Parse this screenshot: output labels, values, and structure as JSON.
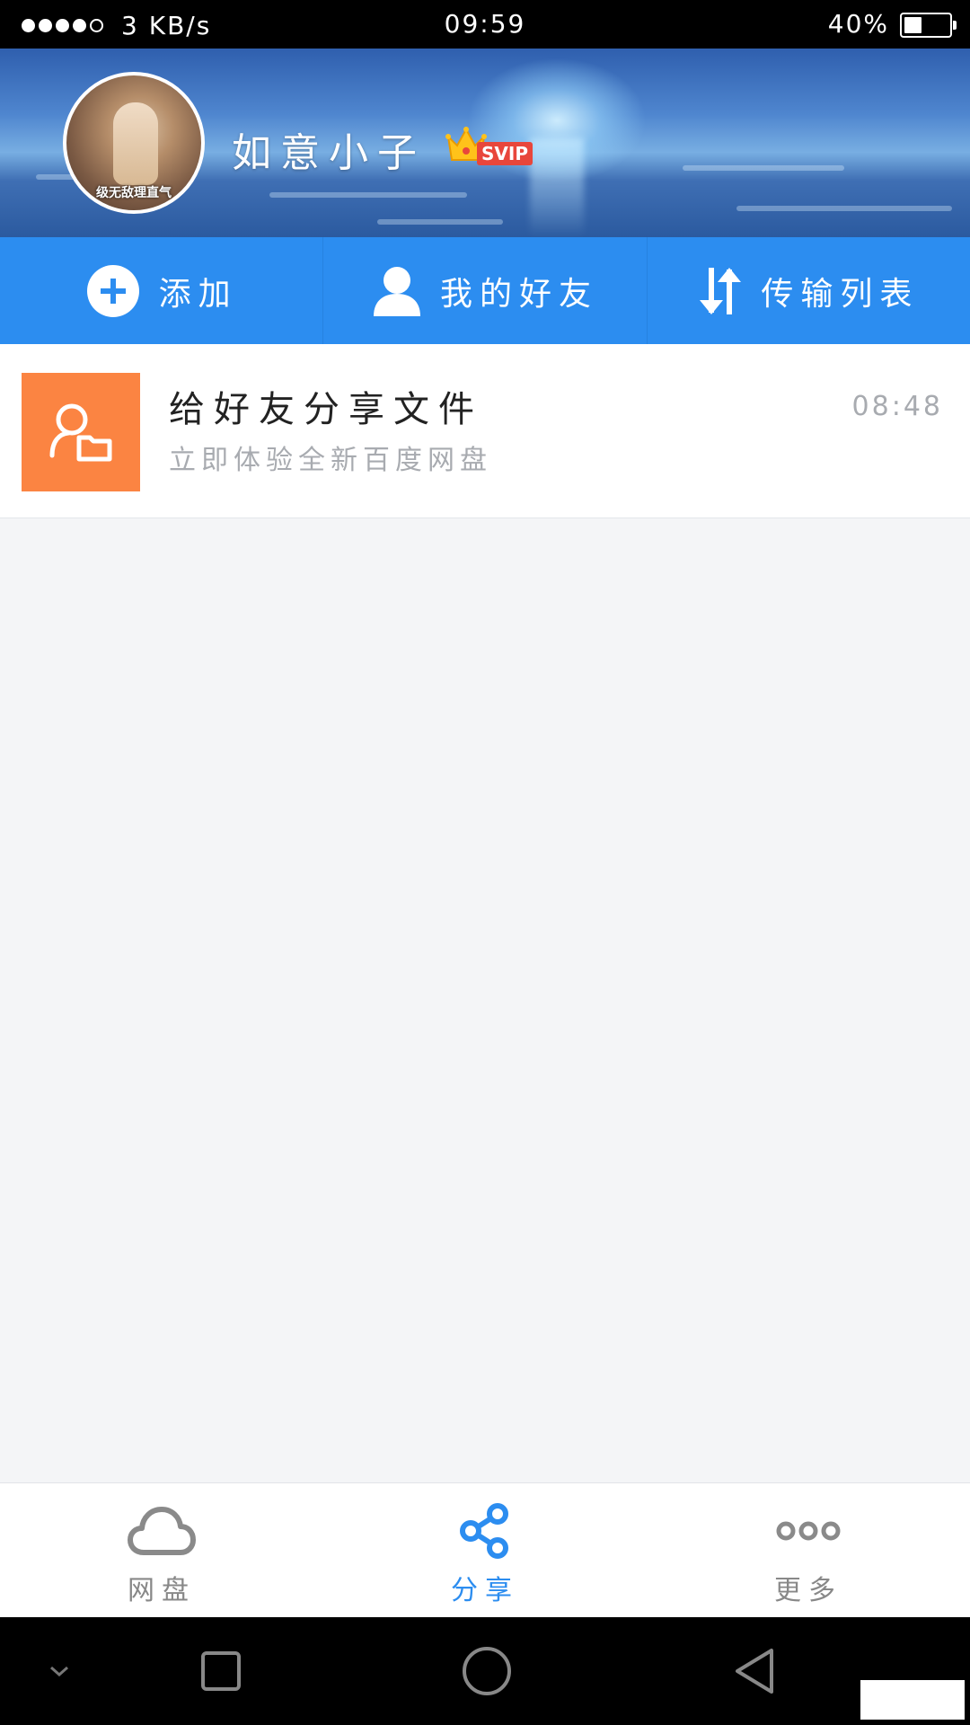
{
  "status_bar": {
    "signal_strength": 4,
    "network_speed": "3 KB/s",
    "time": "09:59",
    "battery_percent_text": "40%",
    "battery_level": 0.4
  },
  "profile": {
    "username": "如意小子",
    "badge": "SVIP",
    "avatar_caption": "级无敌理直气"
  },
  "actions": [
    {
      "label": "添加",
      "icon": "plus-circle-icon"
    },
    {
      "label": "我的好友",
      "icon": "person-icon"
    },
    {
      "label": "传输列表",
      "icon": "transfer-arrows-icon"
    }
  ],
  "messages": [
    {
      "title": "给好友分享文件",
      "subtitle": "立即体验全新百度网盘",
      "time": "08:48",
      "icon": "share-folder-icon",
      "icon_color": "#fb8442"
    }
  ],
  "bottom_nav": [
    {
      "label": "网盘",
      "icon": "cloud-icon",
      "active": false
    },
    {
      "label": "分享",
      "icon": "share-icon",
      "active": true
    },
    {
      "label": "更多",
      "icon": "more-dots-icon",
      "active": false
    }
  ],
  "colors": {
    "accent": "#2c8df0",
    "orange": "#fb8442",
    "background": "#f4f5f7"
  }
}
